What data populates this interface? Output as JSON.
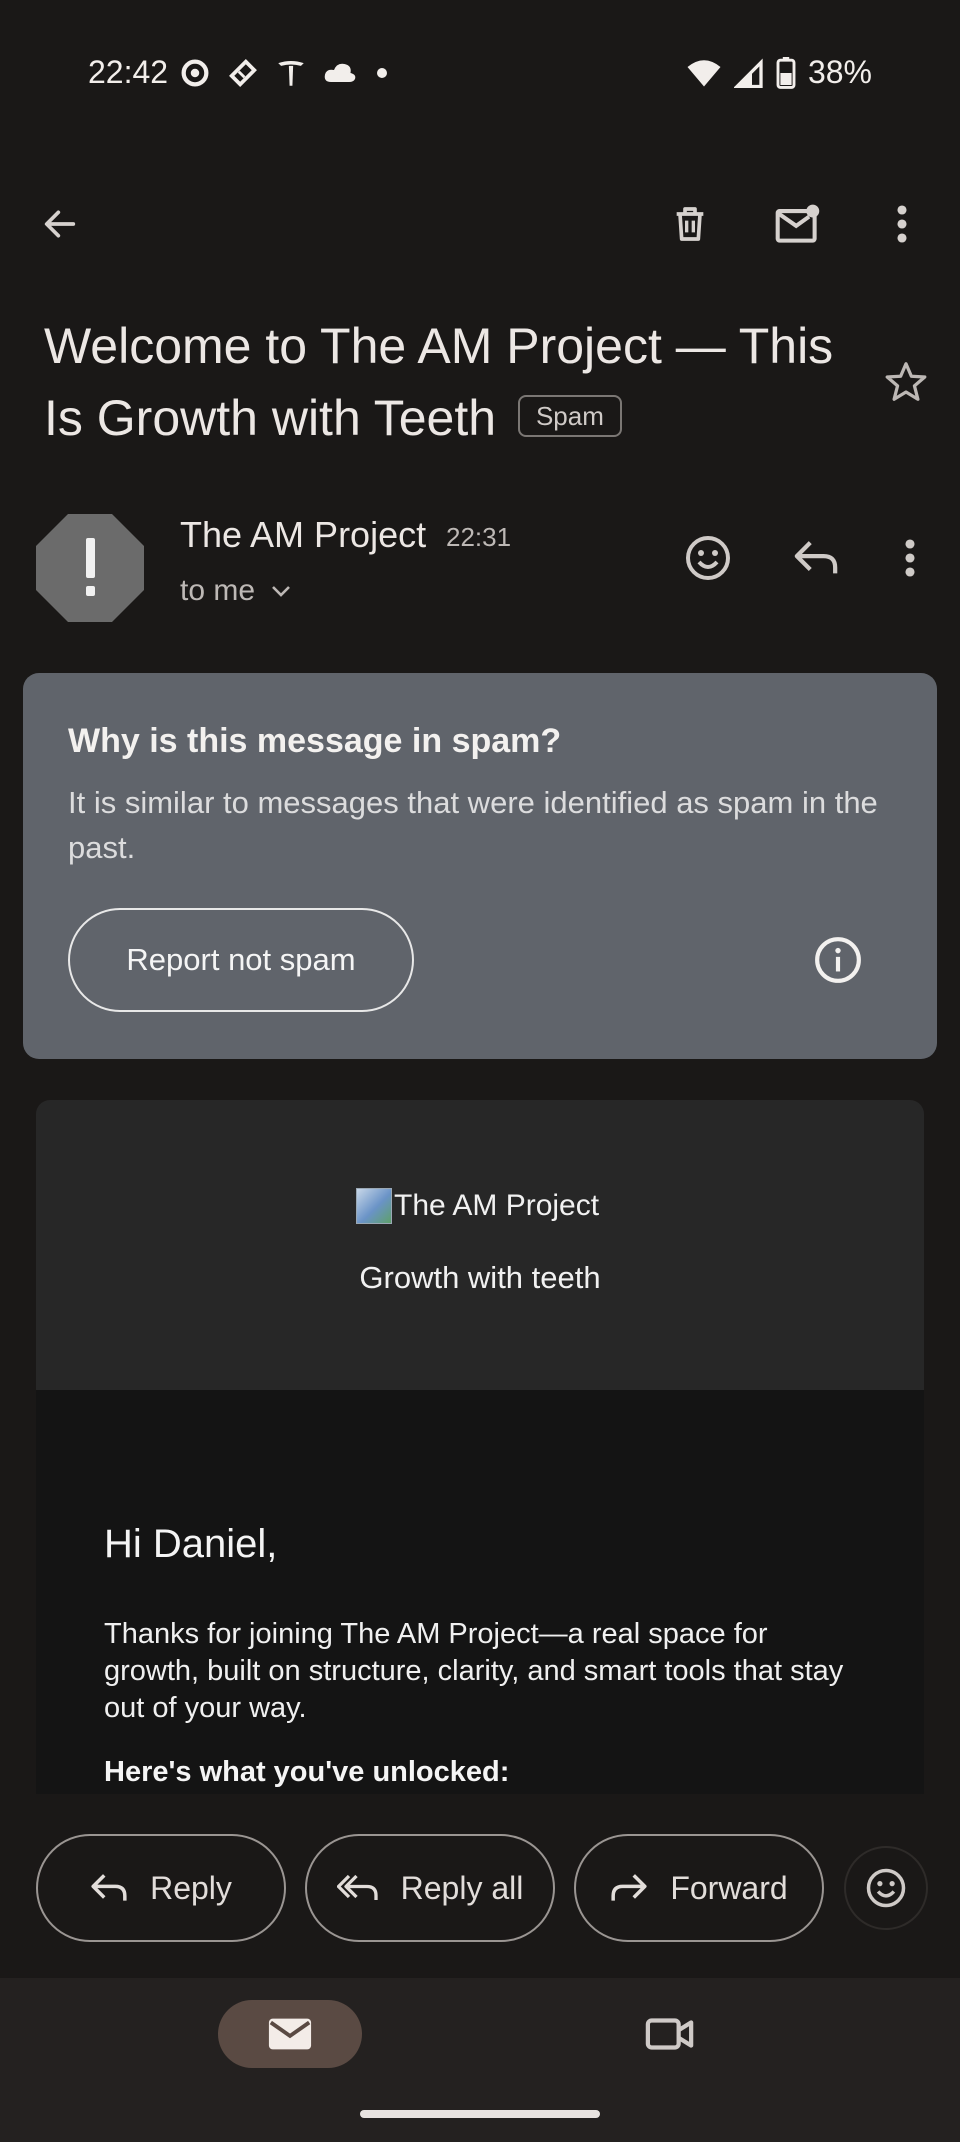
{
  "status_bar": {
    "time": "22:42",
    "battery": "38%",
    "left_icons": [
      "sync-icon",
      "ticket-icon",
      "tesla-icon",
      "cloud-icon",
      "dot-icon"
    ],
    "right_icons": [
      "wifi-icon",
      "signal-icon",
      "battery-icon"
    ]
  },
  "toolbar": {
    "back": "back-icon",
    "delete": "trash-icon",
    "mark_unread": "mail-unread-icon",
    "more": "overflow-icon"
  },
  "email": {
    "subject": "Welcome to The AM Project — This Is Growth with Teeth",
    "label": "Spam",
    "sender_name": "The AM Project",
    "sent_time": "22:31",
    "recipient": "to me"
  },
  "spam_notice": {
    "title": "Why is this message in spam?",
    "body": "It is similar to messages that were identified as spam in the past.",
    "action_label": "Report not spam"
  },
  "content": {
    "logo_alt": "The AM Project",
    "tagline": "Growth with teeth",
    "greeting": "Hi Daniel,",
    "intro": "Thanks for joining The AM Project—a real space for growth, built on structure, clarity, and smart tools that stay out of your way.",
    "unlocked_heading": "Here's what you've unlocked:"
  },
  "actions": {
    "reply": "Reply",
    "reply_all": "Reply all",
    "forward": "Forward"
  },
  "bottom_nav": {
    "mail": "mail-icon",
    "meet": "video-icon"
  },
  "colors": {
    "background": "#1a1817",
    "spam_card": "#60646b",
    "nav_active": "#5a4a43"
  }
}
